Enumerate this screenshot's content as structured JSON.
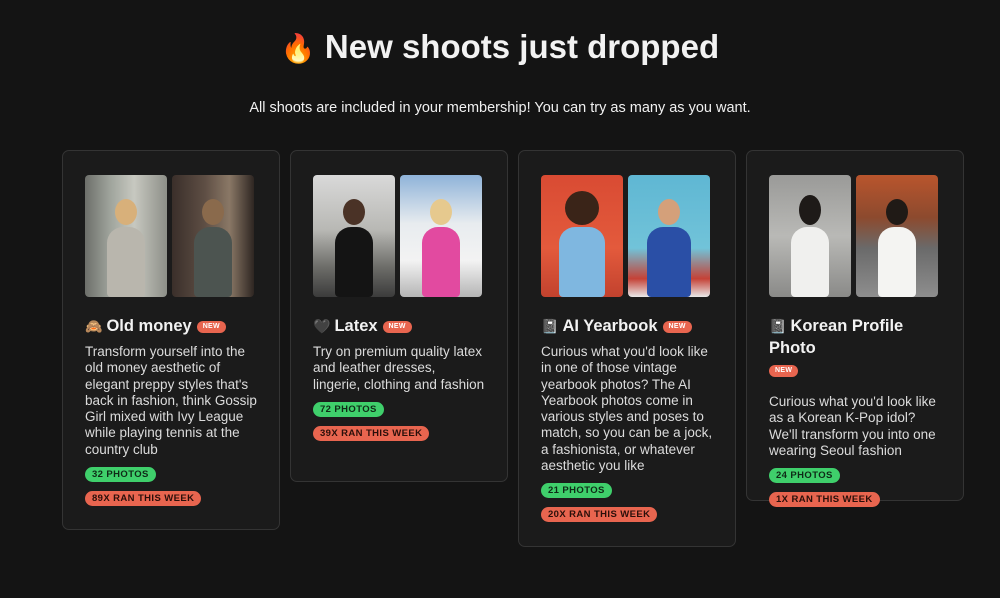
{
  "header": {
    "title": "New shoots just dropped",
    "title_icon": "fire-icon",
    "subtitle": "All shoots are included in your membership! You can try as many as you want."
  },
  "shoots": [
    {
      "emoji": "🙈",
      "title": "Old money",
      "badge": "NEW",
      "description": "Transform yourself into the old money aesthetic of elegant preppy styles that's back in fashion, think Gossip Girl mixed with Ivy League while playing tennis at the country club",
      "photos": "32 PHOTOS",
      "runs": "89X RAN THIS WEEK"
    },
    {
      "emoji": "🖤",
      "title": "Latex",
      "badge": "NEW",
      "description": "Try on premium quality latex and leather dresses, lingerie, clothing and fashion",
      "photos": "72 PHOTOS",
      "runs": "39X RAN THIS WEEK"
    },
    {
      "emoji": "📓",
      "title": "AI Yearbook",
      "badge": "NEW",
      "description": "Curious what you'd look like in one of those vintage yearbook photos? The AI Yearbook photos come in various styles and poses to match, so you can be a jock, a fashionista, or whatever aesthetic you like",
      "photos": "21 PHOTOS",
      "runs": "20X RAN THIS WEEK"
    },
    {
      "emoji": "📓",
      "title": "Korean Profile Photo",
      "badge": "NEW",
      "description": "Curious what you'd look like as a Korean K-Pop idol? We'll transform you into one wearing Seoul fashion",
      "photos": "24 PHOTOS",
      "runs": "1X RAN THIS WEEK"
    }
  ],
  "colors": {
    "background": "#141414",
    "card": "#1b1b1b",
    "accent_green": "#3fcf6b",
    "accent_red": "#e8654f"
  }
}
